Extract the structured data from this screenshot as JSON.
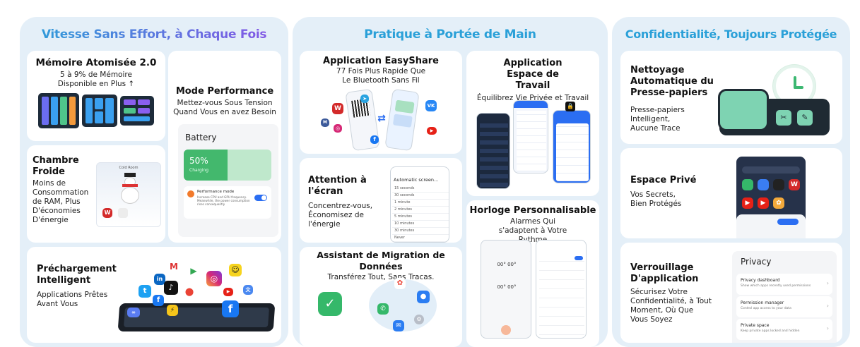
{
  "colors": {
    "panel_bg": "#e4eff8",
    "title1_start": "#2aa0d8",
    "title1_end": "#8a52e6",
    "title2": "#2aa0d8",
    "title3": "#2aa0d8",
    "slab": "#7ed3b2",
    "toggle": "#2b6ef2"
  },
  "panels": [
    {
      "title": "Vitesse Sans Effort, à Chaque Fois"
    },
    {
      "title": "Pratique à Portée de Main"
    },
    {
      "title": "Confidentialité, Toujours Protégée"
    }
  ],
  "memoire": {
    "title": "Mémoire Atomisée 2.0",
    "subtitle": "5 à 9% de Mémoire Disponible en Plus ↑"
  },
  "performance": {
    "title": "Mode Performance",
    "subtitle": "Mettez-vous Sous Tension Quand Vous en avez Besoin",
    "battery_label": "Battery",
    "battery_percent": "50%",
    "battery_level": 0.5,
    "battery_state": "Charging",
    "mode_label": "Performance mode",
    "mode_desc": "Increase CPU and GPU frequency. Meanwhile, the power consumption rises consequently"
  },
  "chambre": {
    "title": "Chambre Froide",
    "subtitle": "Moins de Consommation de RAM, Plus D'économies D'énergie",
    "mock_title": "Cold Room"
  },
  "prechargement": {
    "title": "Préchargement Intelligent",
    "subtitle": "Applications Prêtes Avant Vous"
  },
  "easyshare": {
    "title": "Application EasyShare",
    "subtitle": "77 Fois Plus Rapide Que Le Bluetooth Sans Fil"
  },
  "espace_travail": {
    "title": "Application Espace de Travail",
    "subtitle": "Équilibrez Vie Privée et Travail"
  },
  "attention": {
    "title": "Attention à l'écran",
    "subtitle": "Concentrez-vous, Économisez de l'énergie",
    "mock_title": "Automatic screen..."
  },
  "horloge": {
    "title": "Horloge Personnalisable",
    "subtitle": "Alarmes Qui s'adaptent à Votre Rythme"
  },
  "migration": {
    "title": "Assistant de Migration de Données",
    "subtitle": "Transférez Tout, Sans Tracas."
  },
  "nettoyage": {
    "title": "Nettoyage Automatique du Presse-papiers",
    "subtitle": "Presse-papiers Intelligent, Aucune Trace"
  },
  "espace_prive": {
    "title": "Espace Privé",
    "subtitle": "Vos Secrets, Bien Protégés"
  },
  "verrouillage": {
    "title": "Verrouillage D'application",
    "subtitle": "Sécurisez Votre Confidentialité, à Tout Moment, Où Que Vous Soyez",
    "privacy": {
      "heading": "Privacy",
      "items": [
        {
          "title": "Privacy dashboard",
          "desc": "Show which apps recently used permissions"
        },
        {
          "title": "Permission manager",
          "desc": "Control app access to your data"
        },
        {
          "title": "Private space",
          "desc": "Keep private apps locked and hidden"
        }
      ]
    }
  }
}
